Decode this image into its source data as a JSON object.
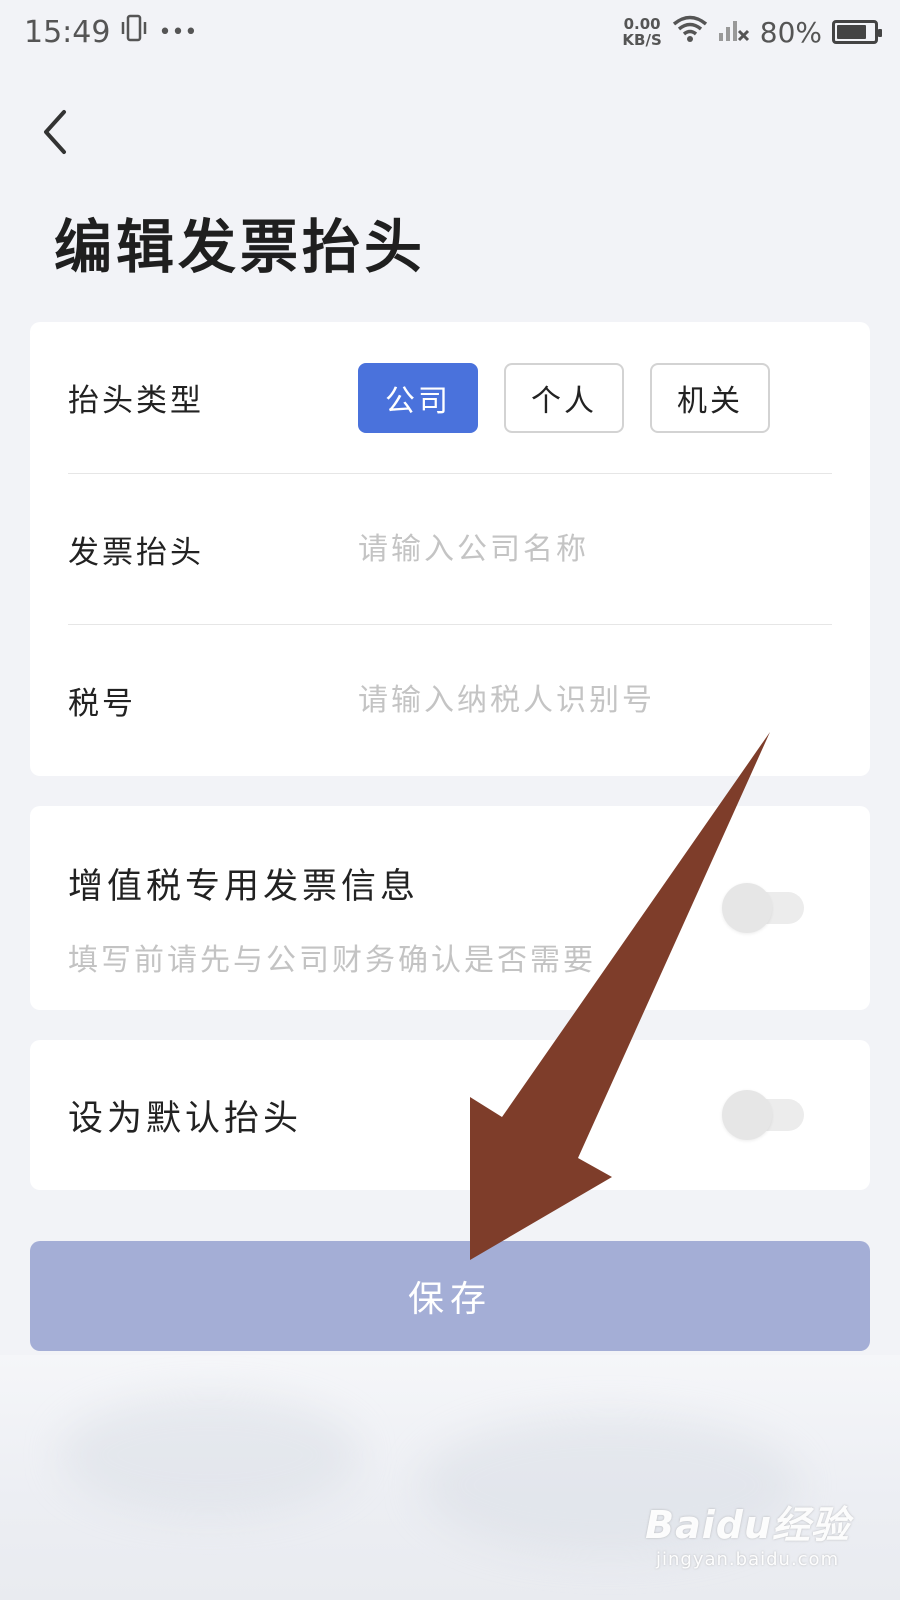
{
  "status_bar": {
    "time": "15:49",
    "more": "•••",
    "net_speed_value": "0.00",
    "net_speed_unit": "KB/S",
    "battery": "80%",
    "battery_level": 0.8
  },
  "header": {
    "title": "编辑发票抬头"
  },
  "form": {
    "type_label": "抬头类型",
    "type_options": [
      "公司",
      "个人",
      "机关"
    ],
    "selected_type": "公司",
    "title_label": "发票抬头",
    "title_placeholder": "请输入公司名称",
    "title_value": "",
    "tax_label": "税号",
    "tax_placeholder": "请输入纳税人识别号",
    "tax_value": ""
  },
  "vat": {
    "title": "增值税专用发票信息",
    "subtitle": "填写前请先与公司财务确认是否需要",
    "enabled": false
  },
  "default_header": {
    "title": "设为默认抬头",
    "enabled": false
  },
  "save_button": {
    "label": "保存"
  },
  "colors": {
    "accent": "#4a72dc",
    "save_disabled": "#a4aed6",
    "arrow": "#7e3d2a"
  },
  "watermark": {
    "logo": "Baidu经验",
    "url": "jingyan.baidu.com"
  }
}
